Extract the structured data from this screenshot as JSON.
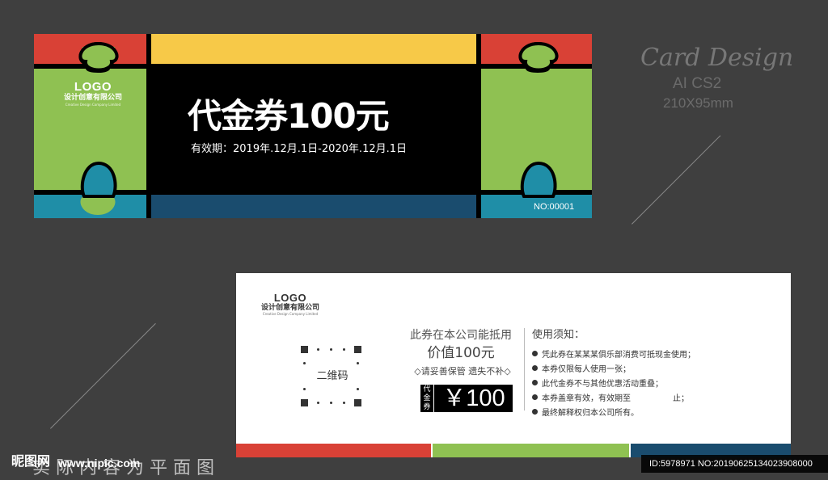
{
  "colors": {
    "background": "#3f3f3f",
    "red": "#d94136",
    "yellow": "#f7c948",
    "green": "#8fc152",
    "teal": "#1f8ea7",
    "navy": "#1a4c6e",
    "black": "#000000"
  },
  "front": {
    "logo": "LOGO",
    "company": "设计创意有限公司",
    "company_en": "Creative Design Company Limited",
    "title": "代金券100元",
    "validity": "有效期：2019年.12月.1日-2020年.12月.1日",
    "serial": "NO:00001"
  },
  "caption": {
    "title": "Card Design",
    "software": "AI CS2",
    "size": "210X95mm"
  },
  "back": {
    "logo": "LOGO",
    "company": "设计创意有限公司",
    "company_en": "Creative Design Company Limited",
    "qr_label": "二维码",
    "deduct_text": "此券在本公司能抵用",
    "deduct_value": "价值100元",
    "keep_text": "◇请妥善保管 遗失不补◇",
    "price_tag": "代金券",
    "price_value": "￥100",
    "notes_title": "使用须知：",
    "notes": [
      "凭此券在某某某俱乐部消费可抵现金使用；",
      "本券仅限每人使用一张；",
      "此代金券不与其他优惠活动重叠；",
      "本券盖章有效，有效期至",
      "最终解释权归本公司所有。"
    ],
    "notes_end": "止；"
  },
  "watermark": {
    "site_logo": "昵图网",
    "url": "www.nipic.com",
    "caption": "实际内容为平面图",
    "id_text": "ID:5978971 NO:20190625134023908000"
  }
}
